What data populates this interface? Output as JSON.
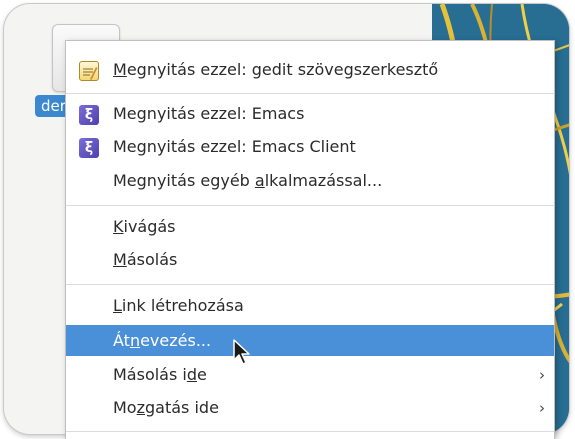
{
  "desktop": {
    "icon_label": "der"
  },
  "menu": {
    "open_with_gedit": {
      "prefix": "M",
      "rest": "egnyitás ezzel: gedit szövegszerkesztő"
    },
    "open_with_emacs": "Megnyitás ezzel: Emacs",
    "open_with_emacs_client": "Megnyitás ezzel: Emacs Client",
    "open_with_other": {
      "before": "Megnyitás egyéb ",
      "underline": "a",
      "after": "lkalmazással..."
    },
    "cut": {
      "underline": "K",
      "rest": "ivágás"
    },
    "copy": {
      "underline": "M",
      "rest": "ásolás"
    },
    "make_link": {
      "underline": "L",
      "rest": "ink létrehozása"
    },
    "rename": {
      "before": "Át",
      "underline": "n",
      "after": "evezés..."
    },
    "copy_to": {
      "before": "Másolás i",
      "underline": "d",
      "after": "e",
      "chevron": "›"
    },
    "move_to": {
      "before": "Mo",
      "underline": "z",
      "after": "gatás ide",
      "chevron": "›"
    }
  },
  "icons": {
    "gedit": "text-editor-icon",
    "emacs": "emacs-icon",
    "emacs_glyph": "ξ"
  },
  "colors": {
    "highlight": "#4a90d9",
    "label_bg": "#3b88d0"
  }
}
